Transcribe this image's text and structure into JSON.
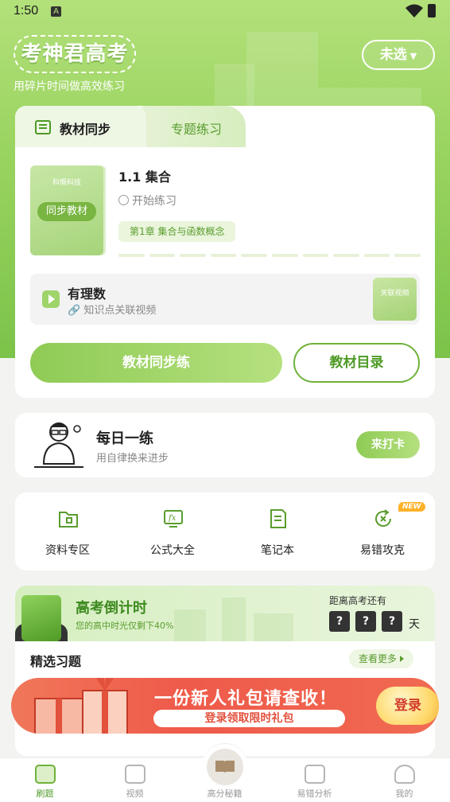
{
  "status_bar": {
    "time": "1:50",
    "notif_icon": "A"
  },
  "header": {
    "logo_text": "考神君高考",
    "slogan": "用碎片时间做高效练习",
    "select_label": "未选"
  },
  "tabs": [
    {
      "label": "教材同步"
    },
    {
      "label": "专题练习"
    }
  ],
  "lesson": {
    "publisher": "科慨科技",
    "book_tag": "同步教材",
    "title": "1.1 集合",
    "start_label": "开始练习",
    "chapter": "第1章 集合与函数概念"
  },
  "video": {
    "title": "有理数",
    "subtitle": "知识点关联视频",
    "badge": "关联视频"
  },
  "buttons": {
    "sync": "教材同步练",
    "catalog": "教材目录"
  },
  "daily": {
    "title": "每日一练",
    "subtitle": "用自律换来进步",
    "checkin": "来打卡"
  },
  "tools": [
    {
      "label": "资料专区"
    },
    {
      "label": "公式大全"
    },
    {
      "label": "笔记本"
    },
    {
      "label": "易错攻克"
    }
  ],
  "new_badge": "NEW",
  "exam": {
    "title": "高考倒计时",
    "subtitle": "您的高中时光仅剩下40%",
    "remain_label": "距离高考还有",
    "digits": [
      "?",
      "?",
      "?"
    ],
    "unit": "天"
  },
  "picks": {
    "title": "精选习题",
    "see_more": "查看更多"
  },
  "gift": {
    "title": "一份新人礼包请查收！",
    "subtitle": "登录领取限时礼包",
    "login": "登录"
  },
  "nav": [
    {
      "label": "刷题"
    },
    {
      "label": "视频"
    },
    {
      "label": "高分秘籍"
    },
    {
      "label": "易错分析"
    },
    {
      "label": "我的"
    }
  ],
  "colors": {
    "brand": "#7cc34a",
    "accent_dark": "#4f9a26",
    "gift_red": "#ef5a4a"
  }
}
